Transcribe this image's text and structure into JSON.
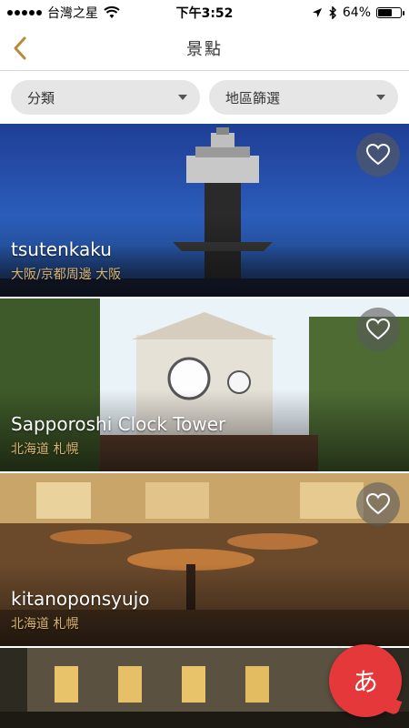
{
  "status_bar": {
    "carrier": "台灣之星",
    "time": "下午3:52",
    "battery_text": "64%",
    "battery_level": 0.64
  },
  "nav": {
    "title": "景點",
    "back_icon": "chevron-left-icon",
    "accent": "#b98a3c"
  },
  "filters": [
    {
      "label": "分類"
    },
    {
      "label": "地區篩選"
    }
  ],
  "attractions": [
    {
      "name": "tsutenkaku",
      "location": "大阪/京都周邊 大阪"
    },
    {
      "name": "Sapporoshi Clock Tower",
      "location": "北海道 札幌"
    },
    {
      "name": "kitanoponsyujo",
      "location": "北海道 札幌"
    },
    {
      "name": "",
      "location": ""
    }
  ],
  "fab": {
    "label": "あ",
    "color": "#e5383b"
  }
}
